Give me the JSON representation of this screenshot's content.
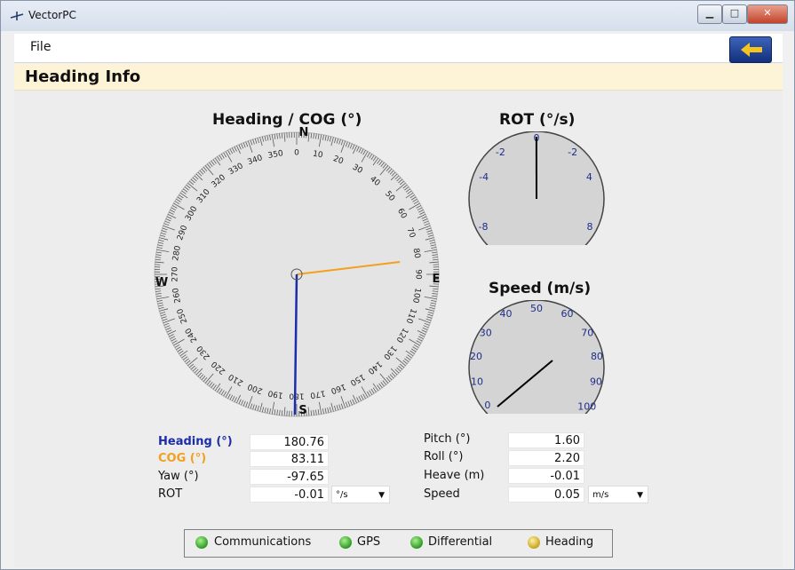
{
  "window": {
    "title": "VectorPC"
  },
  "menu": {
    "file": "File"
  },
  "page": {
    "title": "Heading Info"
  },
  "heading_gauge": {
    "title": "Heading / COG (°)",
    "cardinals": {
      "north": "N",
      "east": "E",
      "south": "S",
      "west": "W"
    },
    "tick_labels": [
      "0",
      "10",
      "20",
      "30",
      "40",
      "50",
      "60",
      "70",
      "80",
      "90",
      "100",
      "110",
      "120",
      "130",
      "140",
      "150",
      "160",
      "170",
      "180",
      "190",
      "200",
      "210",
      "220",
      "230",
      "240",
      "250",
      "260",
      "270",
      "280",
      "290",
      "300",
      "310",
      "320",
      "330",
      "340",
      "350"
    ],
    "heading_deg": 180.76,
    "cog_deg": 83.11,
    "heading_color": "#1c2dab",
    "cog_color": "#f2a01e"
  },
  "rot_gauge": {
    "title": "ROT (°/s)",
    "scale_labels": [
      "0",
      "-2",
      "-2",
      "-4",
      "4",
      "-8",
      "8"
    ],
    "needle_value": -0.01,
    "face_color": "#d4d4d4"
  },
  "speed_gauge": {
    "title": "Speed (m/s)",
    "scale_labels": [
      "0",
      "10",
      "20",
      "30",
      "40",
      "50",
      "60",
      "70",
      "80",
      "90",
      "100"
    ],
    "needle_value": 0.05,
    "face_color": "#d4d4d4"
  },
  "readouts": {
    "heading_label": "Heading (°)",
    "heading_value": "180.76",
    "cog_label": "COG (°)",
    "cog_value": "83.11",
    "yaw_label": "Yaw (°)",
    "yaw_value": "-97.65",
    "rot_label": "ROT",
    "rot_value": "-0.01",
    "rot_unit": "°/s",
    "pitch_label": "Pitch (°)",
    "pitch_value": "1.60",
    "roll_label": "Roll (°)",
    "roll_value": "2.20",
    "heave_label": "Heave (m)",
    "heave_value": "-0.01",
    "speed_label": "Speed",
    "speed_value": "0.05",
    "speed_unit": "m/s"
  },
  "status": [
    {
      "label": "Communications",
      "color": "green"
    },
    {
      "label": "GPS",
      "color": "green"
    },
    {
      "label": "Differential",
      "color": "green"
    },
    {
      "label": "Heading",
      "color": "yellow"
    }
  ]
}
